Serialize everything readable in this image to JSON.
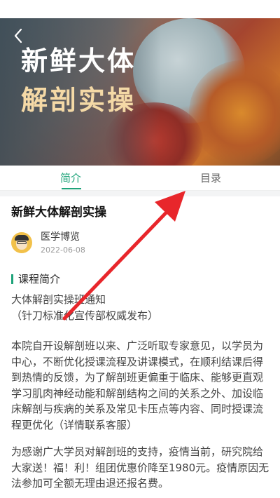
{
  "hero": {
    "title_line1": "新鲜大体",
    "title_line2": "解剖实操",
    "back_icon": "chevron-left-icon"
  },
  "tabs": [
    {
      "label": "简介",
      "active": true
    },
    {
      "label": "目录",
      "active": false
    }
  ],
  "course": {
    "title": "新鲜大体解剖实操",
    "author": "医学博览",
    "date": "2022-06-08"
  },
  "section": {
    "label": "课程简介"
  },
  "content": {
    "p1_line1": "大体解剖实操班通知",
    "p1_line2": "（针刀标准化宣传部权威发布）",
    "p2": "本院自开设解剖班以来、广泛听取专家意见，以学员为中心，不断优化授课流程及讲课模式，在顺利结课后得到热情的反馈，为了解剖班更偏重于临床、能够更直观学习肌肉神经动能和解剖结构之间的关系之外、加设临床解剖与疾病的关系及常见卡压点等内容、同时授课流程更优化（详情联系客服）",
    "p3": "为感谢广大学员对解剖班的支持，疫情当前，研究院给大家送！福！利！组团优惠价降至1980元。疫情原因无法参加可全额无理由退还报名费。"
  },
  "colors": {
    "accent": "#1ea37a",
    "annotation_arrow": "#e8262b"
  }
}
